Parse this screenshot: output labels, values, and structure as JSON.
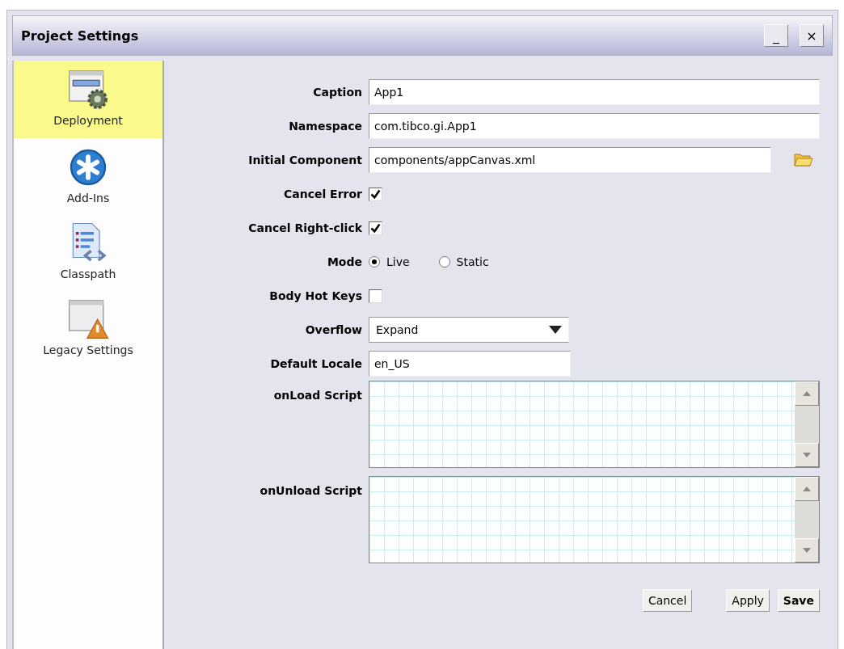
{
  "window": {
    "title": "Project Settings",
    "controls": [
      "_",
      "×"
    ]
  },
  "sidebar": {
    "items": [
      {
        "label": "Deployment",
        "selected": true
      },
      {
        "label": "Add-Ins",
        "selected": false
      },
      {
        "label": "Classpath",
        "selected": false
      },
      {
        "label": "Legacy Settings",
        "selected": false
      }
    ]
  },
  "fields": [
    {
      "kind": "text",
      "label": "Caption",
      "value": "App1",
      "wide": true
    },
    {
      "kind": "text",
      "label": "Namespace",
      "value": "com.tibco.gi.App1",
      "wide": true
    },
    {
      "kind": "browse",
      "label": "Initial Component",
      "value": "components/appCanvas.xml"
    },
    {
      "kind": "checkbox",
      "label": "Cancel Error",
      "checked": true
    },
    {
      "kind": "checkbox",
      "label": "Cancel Right-click",
      "checked": true
    },
    {
      "kind": "radio",
      "label": "Mode",
      "options": [
        {
          "label": "Live",
          "selected": true
        },
        {
          "label": "Static",
          "selected": false
        }
      ]
    },
    {
      "kind": "checkbox",
      "label": "Body Hot Keys",
      "checked": false
    },
    {
      "kind": "select",
      "label": "Overflow",
      "value": "Expand"
    },
    {
      "kind": "text",
      "label": "Default Locale",
      "value": "en_US",
      "wide": false
    },
    {
      "kind": "script",
      "label": "onLoad Script"
    },
    {
      "kind": "script",
      "label": "onUnload Script"
    }
  ],
  "buttons": [
    {
      "label": "Cancel",
      "primary": false
    },
    {
      "label": "Apply",
      "primary": false
    },
    {
      "label": "Save",
      "primary": true
    }
  ]
}
